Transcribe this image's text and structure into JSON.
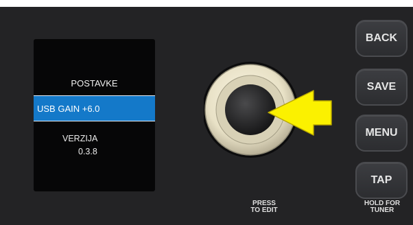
{
  "screen": {
    "title": "POSTAVKE",
    "selected_item": "USB GAIN +6.0",
    "version_label": "VERZIJA",
    "version_value": "0.3.8"
  },
  "buttons": {
    "back": "BACK",
    "save": "SAVE",
    "menu": "MENU",
    "tap": "TAP"
  },
  "captions": {
    "knob_line1": "PRESS",
    "knob_line2": "TO EDIT",
    "tap_line1": "HOLD FOR",
    "tap_line2": "TUNER"
  },
  "icons": {
    "knob": "encoder-knob",
    "pointer": "yellow-arrow-icon"
  },
  "colors": {
    "panel": "#232325",
    "screen": "#060607",
    "selection": "#1479c9",
    "arrow": "#fbf100"
  }
}
